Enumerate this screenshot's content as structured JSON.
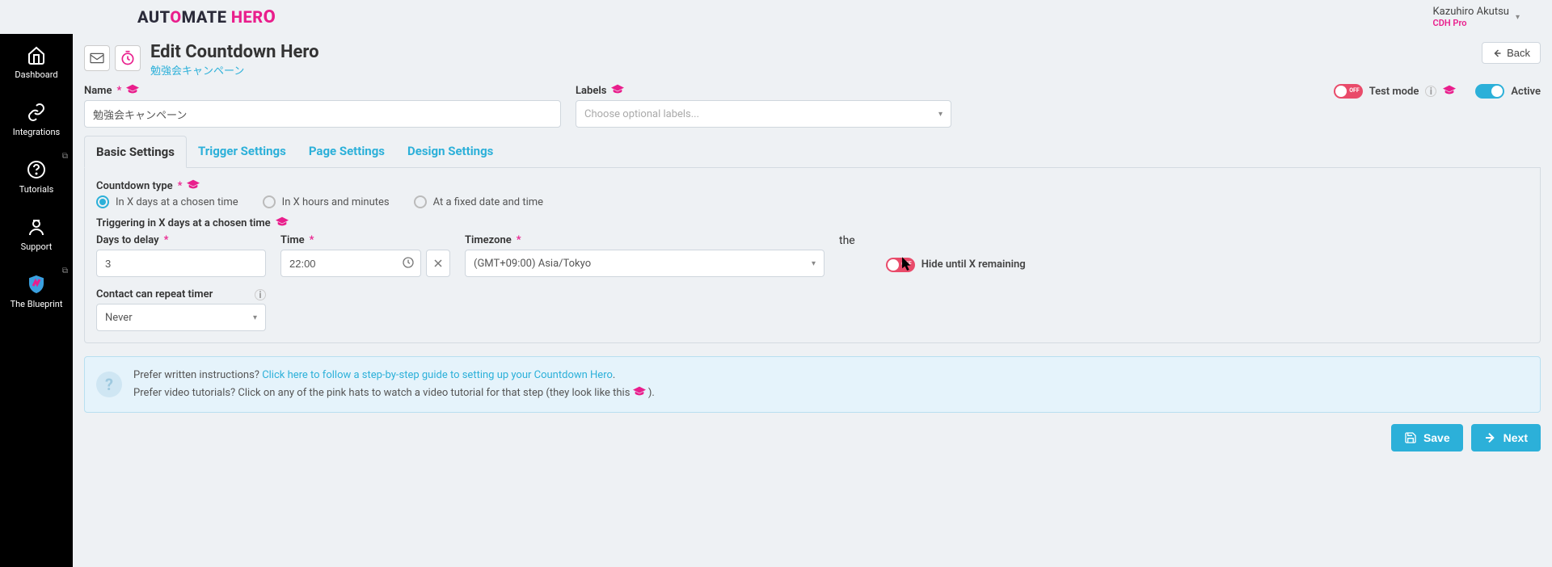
{
  "brand": {
    "part1": "AUT",
    "o": "O",
    "part2": "MATE ",
    "part3": "HER",
    "o2": "O"
  },
  "user": {
    "name": "Kazuhiro Akutsu",
    "role": "CDH Pro"
  },
  "sidebar": {
    "items": [
      {
        "label": "Dashboard"
      },
      {
        "label": "Integrations"
      },
      {
        "label": "Tutorials"
      },
      {
        "label": "Support"
      },
      {
        "label": "The Blueprint"
      }
    ]
  },
  "page": {
    "title": "Edit Countdown Hero",
    "subtitle": "勉強会キャンペーン",
    "back": "Back"
  },
  "nameField": {
    "label": "Name",
    "value": "勉強会キャンペーン"
  },
  "labelsField": {
    "label": "Labels",
    "placeholder": "Choose optional labels..."
  },
  "toggles": {
    "testMode": {
      "label": "Test mode",
      "state": "OFF"
    },
    "active": {
      "label": "Active",
      "state": "ON"
    },
    "hideUntil": {
      "label": "Hide until X remaining",
      "state": "OFF"
    }
  },
  "tabs": [
    {
      "label": "Basic Settings",
      "active": true
    },
    {
      "label": "Trigger Settings"
    },
    {
      "label": "Page Settings"
    },
    {
      "label": "Design Settings"
    }
  ],
  "countdownType": {
    "label": "Countdown type",
    "options": [
      {
        "label": "In X days at a chosen time",
        "selected": true
      },
      {
        "label": "In X hours and minutes"
      },
      {
        "label": "At a fixed date and time"
      }
    ]
  },
  "triggeringHeading": "Triggering in X days at a chosen time",
  "daysField": {
    "label": "Days to delay",
    "value": "3"
  },
  "timeField": {
    "label": "Time",
    "value": "22:00"
  },
  "tzField": {
    "label": "Timezone",
    "value": "(GMT+09:00) Asia/Tokyo"
  },
  "repeatField": {
    "label": "Contact can repeat timer",
    "value": "Never"
  },
  "help": {
    "line1_pre": "Prefer written instructions? ",
    "line1_link": "Click here to follow a step-by-step guide to setting up your Countdown Hero",
    "line1_post": ".",
    "line2": "Prefer video tutorials? Click on any of the pink hats to watch a video tutorial for that step (they look like this ",
    "line2_post": ")."
  },
  "buttons": {
    "save": "Save",
    "next": "Next"
  }
}
